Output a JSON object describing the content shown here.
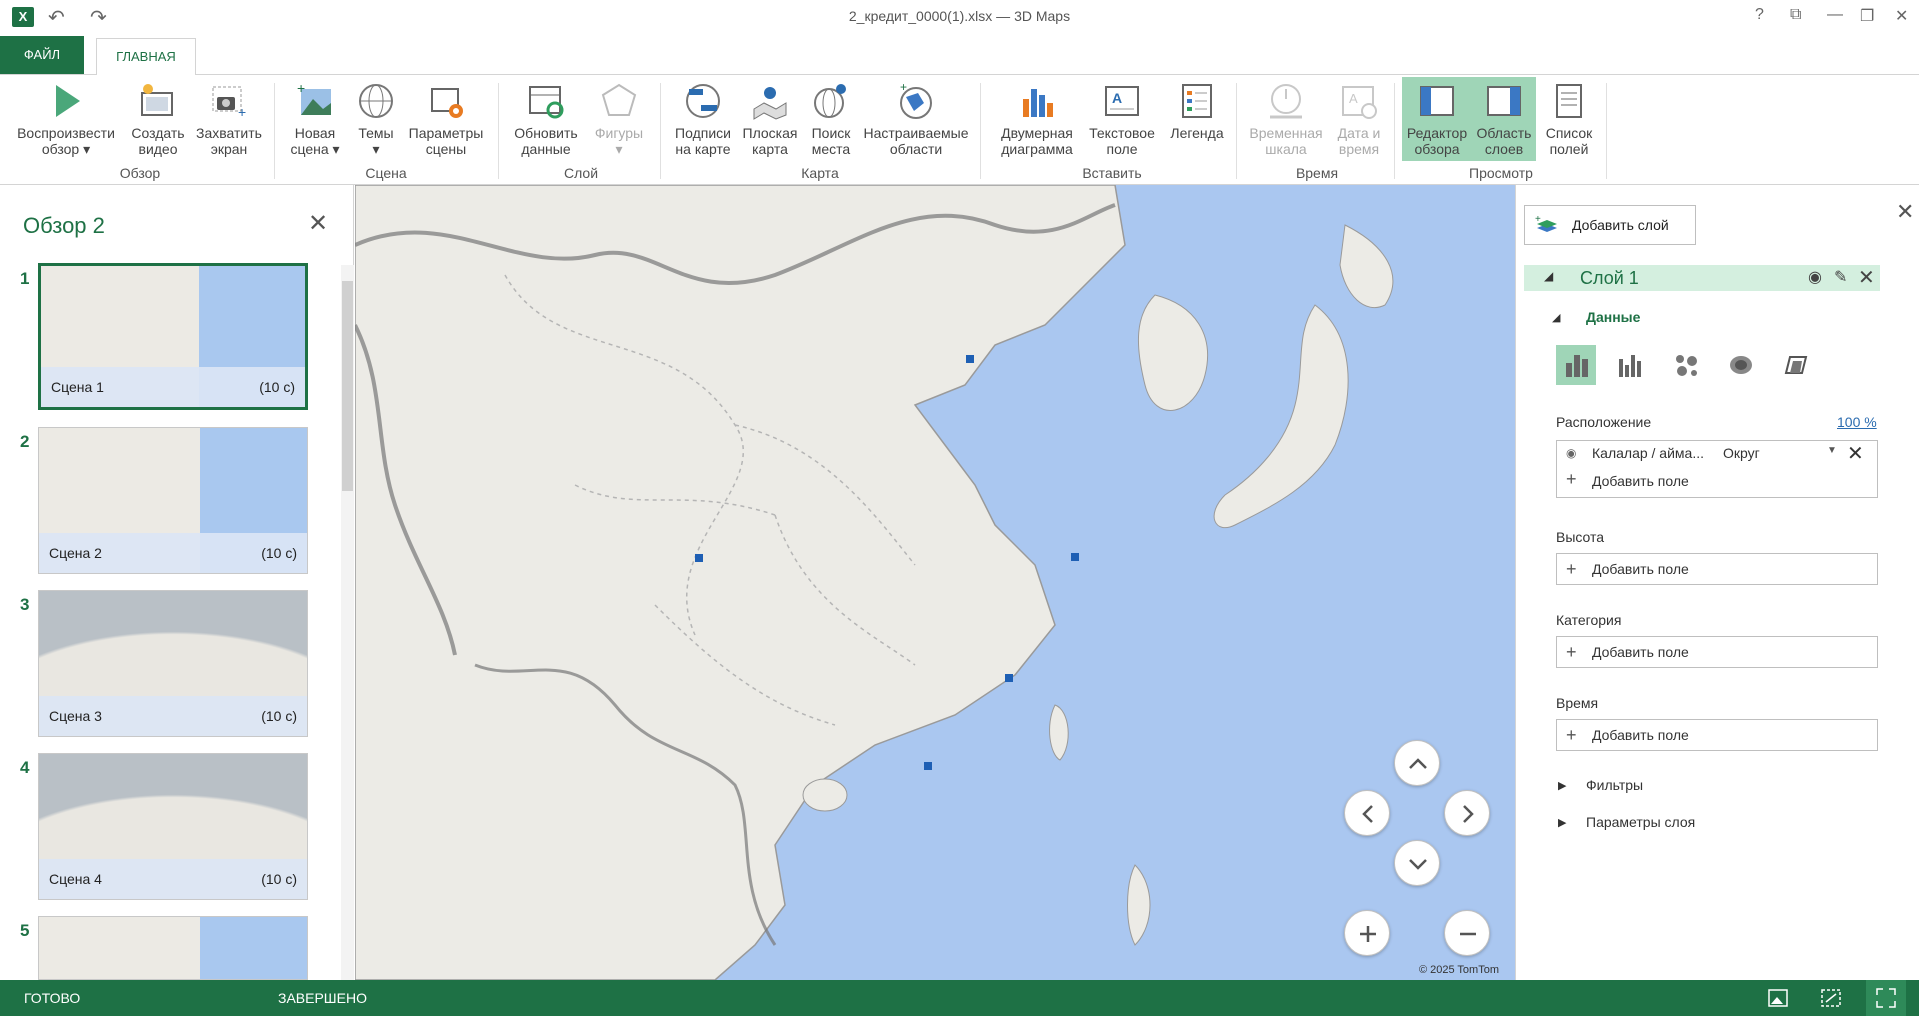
{
  "app": {
    "title": "2_кредит_0000(1).xlsx — 3D Maps",
    "logo": "X"
  },
  "window_controls": [
    "?",
    "⧉",
    "—",
    "❐",
    "✕"
  ],
  "tabs": {
    "file": "ФАЙЛ",
    "home": "ГЛАВНАЯ"
  },
  "ribbon": {
    "buttons": [
      {
        "id": "play",
        "l1": "Воспроизвести",
        "l2": "обзор ▾",
        "icon": "play-icon"
      },
      {
        "id": "video",
        "l1": "Создать",
        "l2": "видео",
        "icon": "video-icon"
      },
      {
        "id": "capture",
        "l1": "Захватить",
        "l2": "экран",
        "icon": "camera-icon"
      },
      {
        "id": "newscene",
        "l1": "Новая",
        "l2": "сцена ▾",
        "icon": "new-scene-icon"
      },
      {
        "id": "themes",
        "l1": "Темы",
        "l2": "▾",
        "icon": "themes-icon"
      },
      {
        "id": "sceneparams",
        "l1": "Параметры",
        "l2": "сцены",
        "icon": "scene-options-icon"
      },
      {
        "id": "refresh",
        "l1": "Обновить",
        "l2": "данные",
        "icon": "refresh-icon"
      },
      {
        "id": "shapes",
        "l1": "Фигуры",
        "l2": "▾",
        "icon": "shapes-icon"
      },
      {
        "id": "maplabels",
        "l1": "Подписи",
        "l2": "на карте",
        "icon": "map-labels-icon"
      },
      {
        "id": "flatmap",
        "l1": "Плоская",
        "l2": "карта",
        "icon": "flat-map-icon"
      },
      {
        "id": "findloc",
        "l1": "Поиск",
        "l2": "места",
        "icon": "find-location-icon"
      },
      {
        "id": "regions",
        "l1": "Настраиваемые",
        "l2": "области",
        "icon": "custom-regions-icon"
      },
      {
        "id": "chart2d",
        "l1": "Двумерная",
        "l2": "диаграмма",
        "icon": "chart-2d-icon"
      },
      {
        "id": "textbox",
        "l1": "Текстовое",
        "l2": "поле",
        "icon": "textbox-icon"
      },
      {
        "id": "legend",
        "l1": "Легенда",
        "l2": "",
        "icon": "legend-icon"
      },
      {
        "id": "timeline",
        "l1": "Временная",
        "l2": "шкала",
        "icon": "timeline-icon"
      },
      {
        "id": "datetime",
        "l1": "Дата и",
        "l2": "время",
        "icon": "date-time-icon"
      },
      {
        "id": "toureditor",
        "l1": "Редактор",
        "l2": "обзора",
        "icon": "tour-editor-icon"
      },
      {
        "id": "layerpane",
        "l1": "Область",
        "l2": "слоев",
        "icon": "layer-pane-icon"
      },
      {
        "id": "fieldlist",
        "l1": "Список",
        "l2": "полей",
        "icon": "field-list-icon"
      }
    ],
    "groups": [
      "Обзор",
      "Сцена",
      "Слой",
      "Карта",
      "Вставить",
      "Время",
      "Просмотр"
    ]
  },
  "tour": {
    "title": "Обзор 2",
    "scenes": [
      {
        "num": "1",
        "name": "Сцена 1",
        "dur": "(10 с)"
      },
      {
        "num": "2",
        "name": "Сцена 2",
        "dur": "(10 с)"
      },
      {
        "num": "3",
        "name": "Сцена 3",
        "dur": "(10 с)"
      },
      {
        "num": "4",
        "name": "Сцена 4",
        "dur": "(10 с)"
      },
      {
        "num": "5",
        "name": "",
        "dur": ""
      }
    ]
  },
  "map": {
    "copyright": "© 2025 TomTom"
  },
  "layer_pane": {
    "add_layer": "Добавить слой",
    "layer_name": "Слой 1",
    "data_section": "Данные",
    "location_label": "Расположение",
    "location_pct": "100 %",
    "location_field": "Калалар / айма...",
    "location_type": "Округ",
    "add_field": "Добавить поле",
    "height_label": "Высота",
    "category_label": "Категория",
    "time_label": "Время",
    "filters": "Фильтры",
    "layer_options": "Параметры слоя"
  },
  "status": {
    "left": "ГОТОВО",
    "mid": "ЗАВЕРШЕНО"
  },
  "colors": {
    "accent": "#1e7145",
    "sea": "#aac7f0",
    "land": "#ecebe6",
    "marker": "#1e5fb4"
  }
}
